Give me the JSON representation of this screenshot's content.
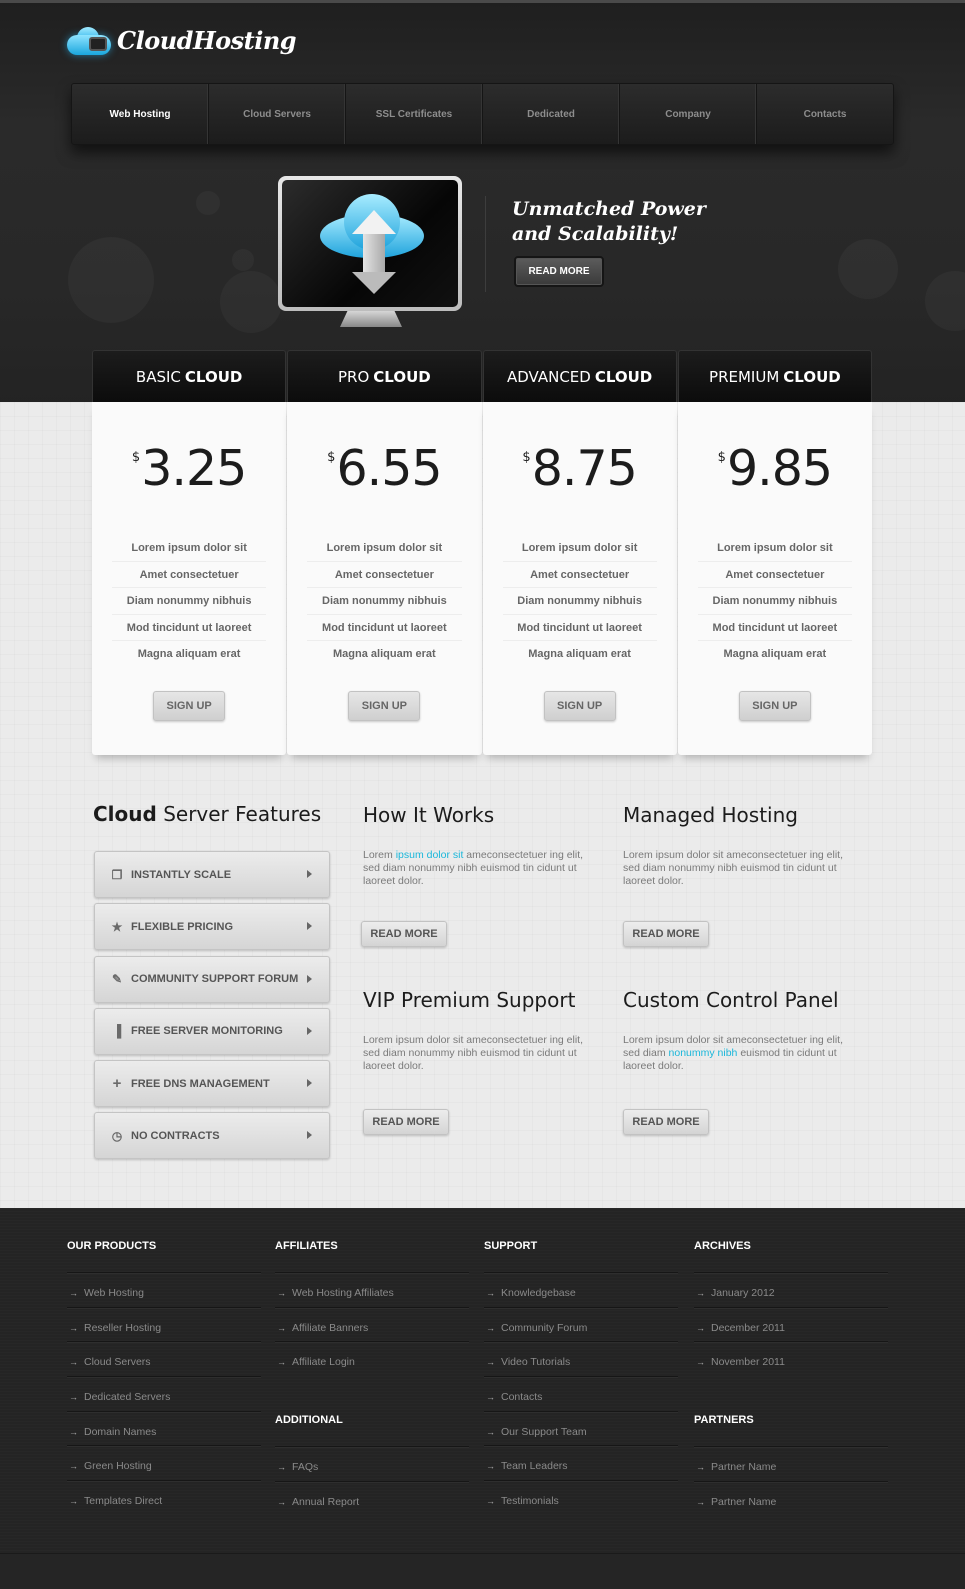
{
  "brand": {
    "name": "CloudHosting"
  },
  "nav": [
    "Web Hosting",
    "Cloud Servers",
    "SSL Certificates",
    "Dedicated",
    "Company",
    "Contacts"
  ],
  "hero": {
    "line1": "Unmatched Power",
    "line2": "and Scalability!",
    "button": "READ MORE"
  },
  "plans": [
    {
      "name_light": "BASIC",
      "name_bold": "CLOUD",
      "currency": "$",
      "price": "3.25",
      "features": [
        "Lorem ipsum dolor sit",
        "Amet consectetuer",
        "Diam nonummy nibhuis",
        "Mod tincidunt ut laoreet",
        "Magna aliquam erat"
      ],
      "button": "SIGN UP"
    },
    {
      "name_light": "PRO",
      "name_bold": "CLOUD",
      "currency": "$",
      "price": "6.55",
      "features": [
        "Lorem ipsum dolor sit",
        "Amet consectetuer",
        "Diam nonummy nibhuis",
        "Mod tincidunt ut laoreet",
        "Magna aliquam erat"
      ],
      "button": "SIGN UP"
    },
    {
      "name_light": "ADVANCED",
      "name_bold": "CLOUD",
      "currency": "$",
      "price": "8.75",
      "features": [
        "Lorem ipsum dolor sit",
        "Amet consectetuer",
        "Diam nonummy nibhuis",
        "Mod tincidunt ut laoreet",
        "Magna aliquam erat"
      ],
      "button": "SIGN UP"
    },
    {
      "name_light": "PREMIUM",
      "name_bold": "CLOUD",
      "currency": "$",
      "price": "9.85",
      "features": [
        "Lorem ipsum dolor sit",
        "Amet consectetuer",
        "Diam nonummy nibhuis",
        "Mod tincidunt ut laoreet",
        "Magna aliquam erat"
      ],
      "button": "SIGN UP"
    }
  ],
  "features_section": {
    "title_bold": "Cloud",
    "title_rest": "Server Features",
    "items": [
      {
        "label": "INSTANTLY SCALE",
        "icon": "windows-icon"
      },
      {
        "label": "FLEXIBLE PRICING",
        "icon": "star-icon"
      },
      {
        "label": "COMMUNITY SUPPORT FORUM",
        "icon": "pencil-icon"
      },
      {
        "label": "FREE SERVER MONITORING",
        "icon": "bar-chart-icon"
      },
      {
        "label": "FREE DNS MANAGEMENT",
        "icon": "plus-icon"
      },
      {
        "label": "NO CONTRACTS",
        "icon": "clock-icon"
      }
    ]
  },
  "info_blocks": [
    {
      "title": "How It Works",
      "text_before": "Lorem ",
      "highlight": "ipsum dolor sit",
      "text_after": " ameconsectetuer ing elit, sed diam nonummy nibh euismod tin cidunt ut laoreet dolor.",
      "button": "READ MORE"
    },
    {
      "title": "Managed Hosting",
      "text_before": "Lorem ipsum dolor sit ameconsectetuer ing elit, sed diam nonummy nibh euismod tin cidunt ut laoreet dolor.",
      "highlight": "",
      "text_after": "",
      "button": "READ MORE"
    },
    {
      "title": "VIP Premium Support",
      "text_before": "Lorem ipsum dolor sit ameconsectetuer ing elit, sed diam nonummy nibh euismod tin cidunt ut laoreet dolor.",
      "highlight": "",
      "text_after": "",
      "button": "READ MORE"
    },
    {
      "title": "Custom Control Panel",
      "text_before": "Lorem ipsum dolor sit ameconsectetuer ing elit, sed diam ",
      "highlight": "nonummy nibh",
      "text_after": " euismod tin cidunt ut laoreet dolor.",
      "button": "READ MORE"
    }
  ],
  "footer": {
    "products": {
      "title": "OUR PRODUCTS",
      "links": [
        "Web Hosting",
        "Reseller Hosting",
        "Cloud Servers",
        "Dedicated Servers",
        "Domain Names",
        "Green Hosting",
        "Templates Direct"
      ]
    },
    "affiliates": {
      "title": "AFFILIATES",
      "links": [
        "Web Hosting Affiliates",
        "Affiliate Banners",
        "Affiliate Login"
      ]
    },
    "additional": {
      "title": "ADDITIONAL",
      "links": [
        "FAQs",
        "Annual Report"
      ]
    },
    "support": {
      "title": "SUPPORT",
      "links": [
        "Knowledgebase",
        "Community Forum",
        "Video Tutorials",
        "Contacts",
        "Our Support Team",
        "Team Leaders",
        "Testimonials"
      ]
    },
    "archives": {
      "title": "ARCHIVES",
      "links": [
        "January 2012",
        "December 2011",
        "November 2011"
      ]
    },
    "partners": {
      "title": "PARTNERS",
      "links": [
        "Partner Name",
        "Partner Name"
      ]
    }
  }
}
